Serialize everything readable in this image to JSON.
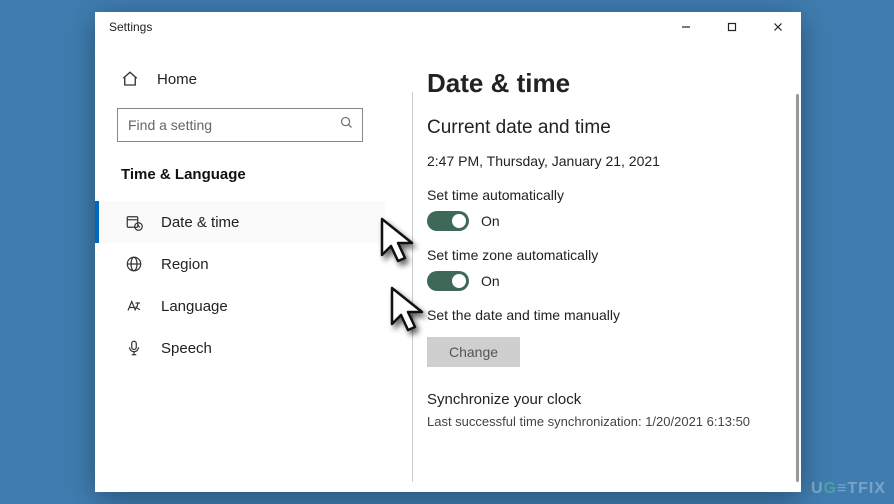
{
  "window": {
    "title": "Settings"
  },
  "sidebar": {
    "home": "Home",
    "search_placeholder": "Find a setting",
    "category": "Time & Language",
    "items": [
      {
        "label": "Date & time"
      },
      {
        "label": "Region"
      },
      {
        "label": "Language"
      },
      {
        "label": "Speech"
      }
    ]
  },
  "content": {
    "title": "Date & time",
    "subtitle": "Current date and time",
    "current": "2:47 PM, Thursday, January 21, 2021",
    "set_time_auto_label": "Set time automatically",
    "set_time_auto_state": "On",
    "set_tz_auto_label": "Set time zone automatically",
    "set_tz_auto_state": "On",
    "manual_label": "Set the date and time manually",
    "change_button": "Change",
    "sync_heading": "Synchronize your clock",
    "sync_sub": "Last successful time synchronization: 1/20/2021 6:13:50"
  },
  "watermark": "UG≡TFIX"
}
